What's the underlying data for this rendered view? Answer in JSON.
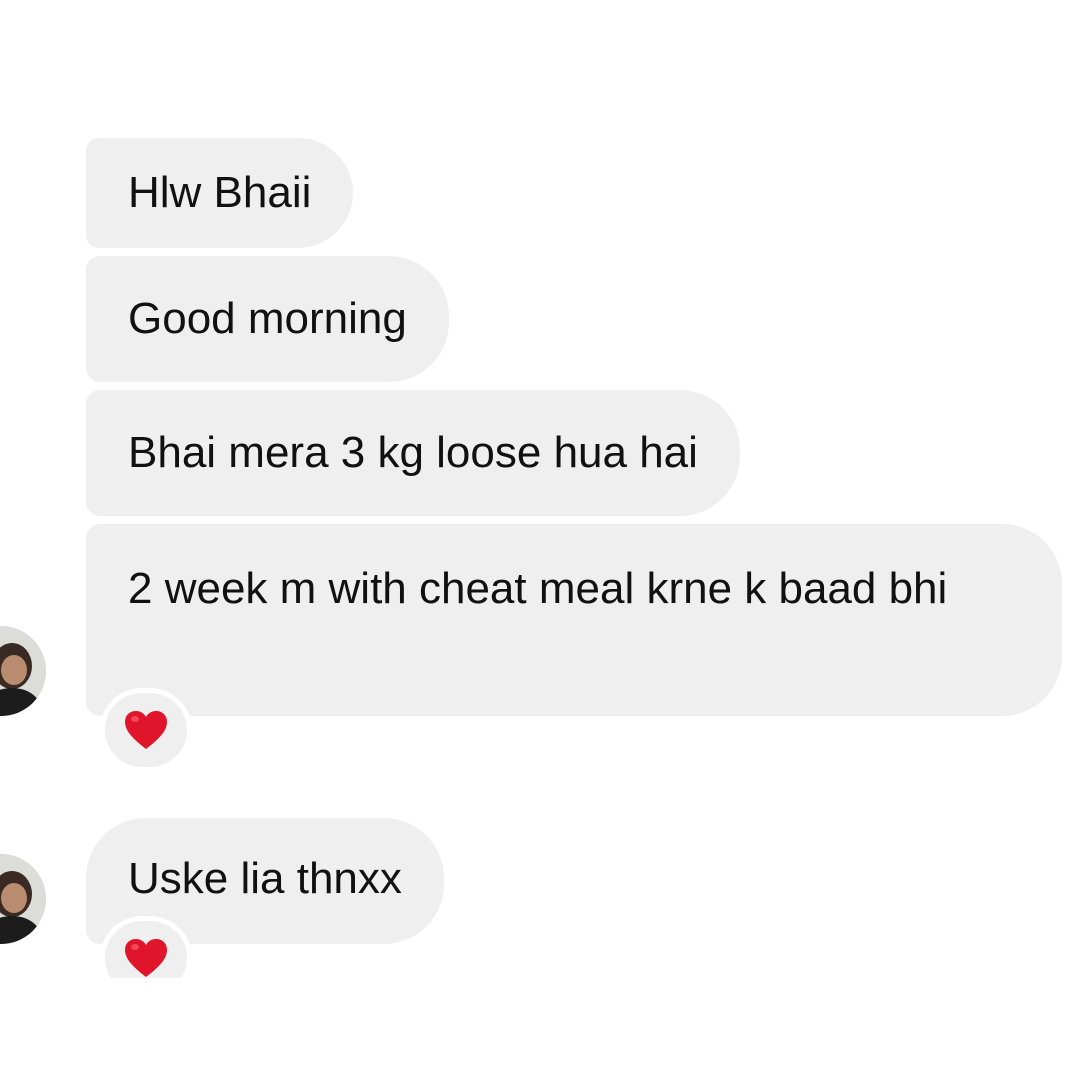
{
  "thread": {
    "messages": [
      {
        "text": "Hlw Bhaii"
      },
      {
        "text": "Good morning"
      },
      {
        "text": "Bhai mera 3 kg loose hua hai"
      },
      {
        "text": "2 week m with cheat meal krne k baad bhi",
        "reaction": "heart-icon"
      },
      {
        "text": "Uske lia thnxx",
        "reaction": "heart-icon"
      }
    ]
  },
  "colors": {
    "bubble": "#efefef",
    "text": "#111111",
    "heart": "#e0152b"
  }
}
